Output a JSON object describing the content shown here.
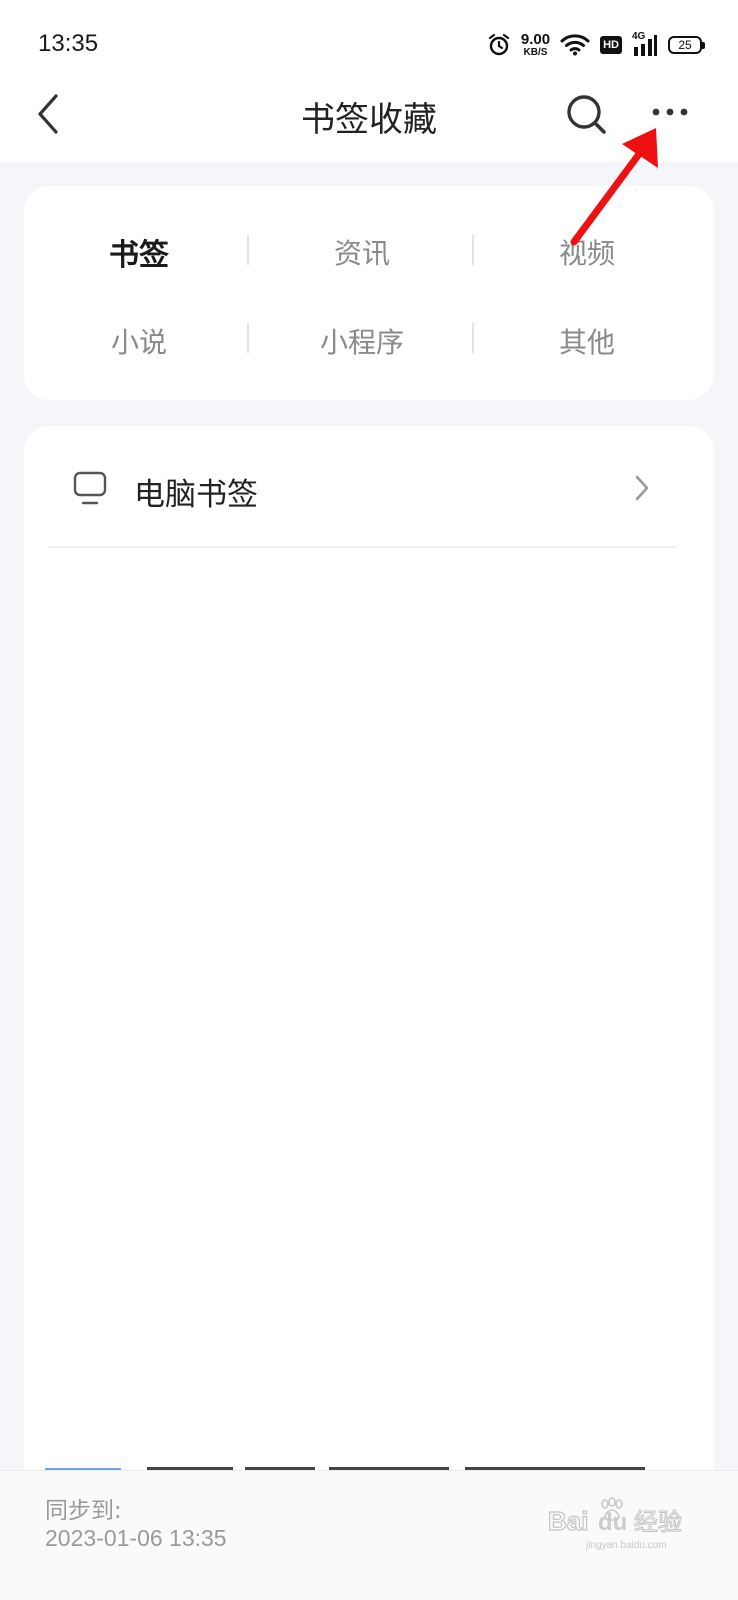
{
  "status_bar": {
    "time": "13:35",
    "net_speed_value": "9.00",
    "net_speed_unit": "KB/S",
    "hd_label": "HD",
    "network_label": "4G",
    "battery_level": "25"
  },
  "nav": {
    "title": "书签收藏"
  },
  "categories": [
    {
      "label": "书签",
      "active": true
    },
    {
      "label": "资讯",
      "active": false
    },
    {
      "label": "视频",
      "active": false
    },
    {
      "label": "小说",
      "active": false
    },
    {
      "label": "小程序",
      "active": false
    },
    {
      "label": "其他",
      "active": false
    }
  ],
  "list": {
    "pc_bookmarks_label": "电脑书签"
  },
  "footer": {
    "sync_label": "同步到:",
    "sync_time": "2023-01-06 13:35"
  },
  "watermark": {
    "text": "Bai du 经验",
    "subtext": "jingyan.baidu.com"
  },
  "colors": {
    "annotation_arrow": "#ee1111",
    "page_background": "#f5f6fa"
  }
}
